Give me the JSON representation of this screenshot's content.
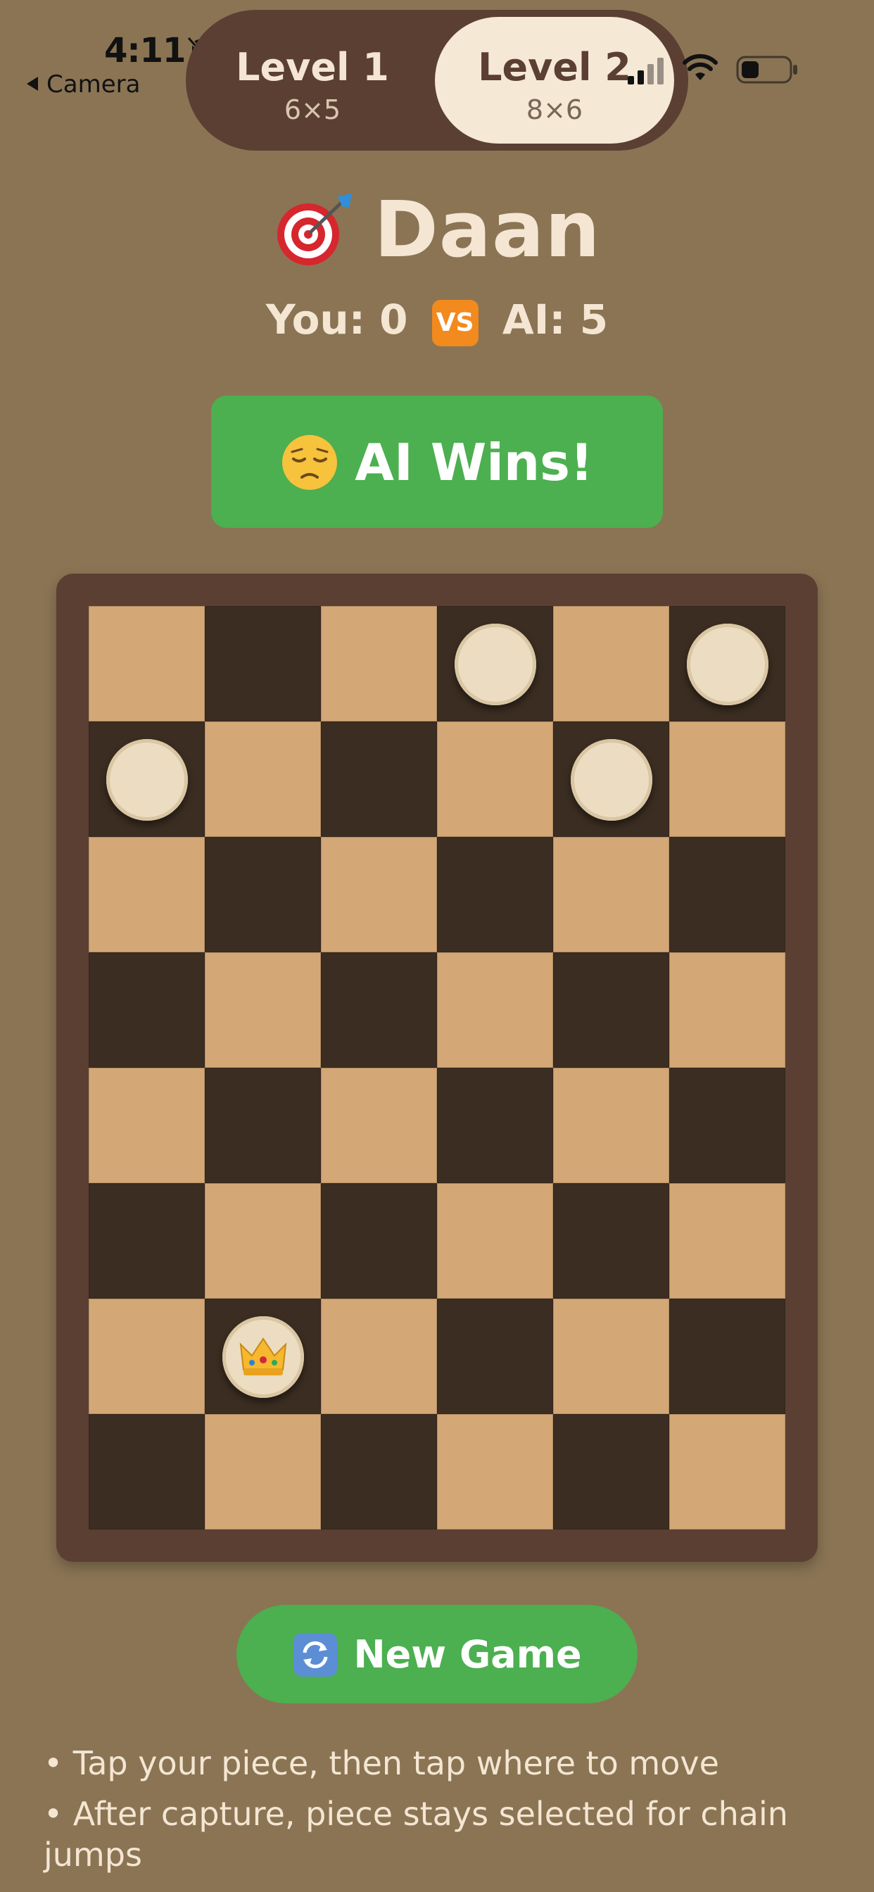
{
  "status_bar": {
    "time": "4:11",
    "back_label": "Camera"
  },
  "levels": [
    {
      "name": "Level 1",
      "size": "6×5",
      "selected": false
    },
    {
      "name": "Level 2",
      "size": "8×6",
      "selected": true
    }
  ],
  "header": {
    "title": "Daan",
    "score_you": "You: 0",
    "vs_label": "VS",
    "score_ai": "AI: 5"
  },
  "result": {
    "text": "AI Wins!"
  },
  "board": {
    "rows": 8,
    "cols": 6,
    "pieces": [
      {
        "row": 0,
        "col": 3,
        "king": false
      },
      {
        "row": 0,
        "col": 5,
        "king": false
      },
      {
        "row": 1,
        "col": 0,
        "king": false
      },
      {
        "row": 1,
        "col": 4,
        "king": false
      },
      {
        "row": 6,
        "col": 1,
        "king": true
      }
    ]
  },
  "actions": {
    "new_game_label": "New Game"
  },
  "instructions": [
    "• Tap your piece, then tap where to move",
    "• After capture, piece stays selected for chain jumps"
  ],
  "colors": {
    "background": "#8a7454",
    "board_frame": "#5b3f33",
    "cell_light": "#d4a776",
    "cell_dark": "#3b2d21",
    "piece": "#ecdcc1",
    "accent_green": "#4caf50",
    "text_cream": "#f4e6d2"
  },
  "icons": {
    "title": "target-dart-icon",
    "result": "sad-face-icon",
    "new_game": "refresh-icon",
    "king": "crown-icon"
  }
}
